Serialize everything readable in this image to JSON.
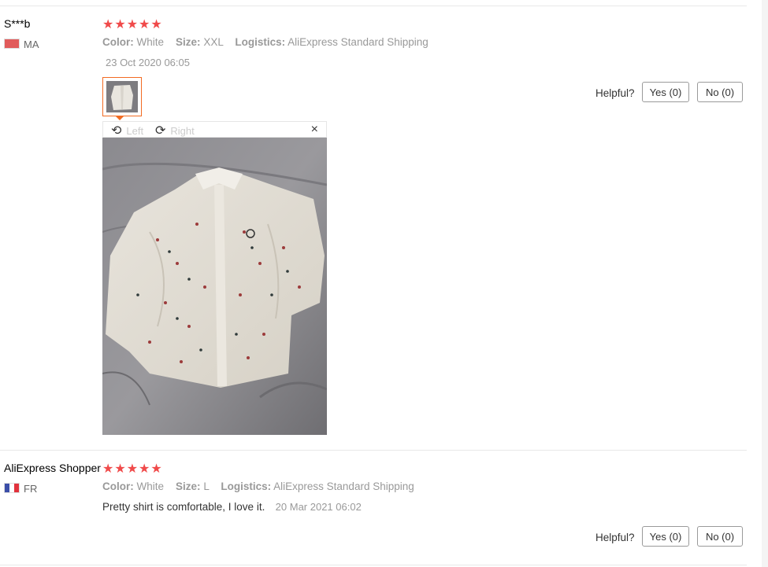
{
  "reviews": [
    {
      "name": "S***b",
      "country": "MA",
      "stars": "★★★★★",
      "color_label": "Color:",
      "color_value": "White",
      "size_label": "Size:",
      "size_value": "XXL",
      "logistics_label": "Logistics:",
      "logistics_value": "AliExpress Standard Shipping",
      "feedback": "",
      "date": "23 Oct 2020 06:05",
      "helpful_label": "Helpful?",
      "yes_label": "Yes (0)",
      "no_label": "No (0)"
    },
    {
      "name": "AliExpress Shopper",
      "country": "FR",
      "stars": "★★★★★",
      "color_label": "Color:",
      "color_value": "White",
      "size_label": "Size:",
      "size_value": "L",
      "logistics_label": "Logistics:",
      "logistics_value": "AliExpress Standard Shipping",
      "feedback": "Pretty shirt is comfortable, I love it.",
      "date": "20 Mar 2021 06:02",
      "helpful_label": "Helpful?",
      "yes_label": "Yes (0)",
      "no_label": "No (0)"
    }
  ],
  "viewer": {
    "rotate_left": "Left",
    "rotate_right": "Right",
    "close_icon": "close-icon",
    "rotate_left_icon": "rotate-left-icon",
    "rotate_right_icon": "rotate-right-icon"
  },
  "colors": {
    "star": "#f04a4a",
    "thumb_border": "#f26b22",
    "flag_ma": "#e15b5b",
    "flag_fr_blue": "#3b4ea8",
    "flag_fr_red": "#e1323c"
  }
}
